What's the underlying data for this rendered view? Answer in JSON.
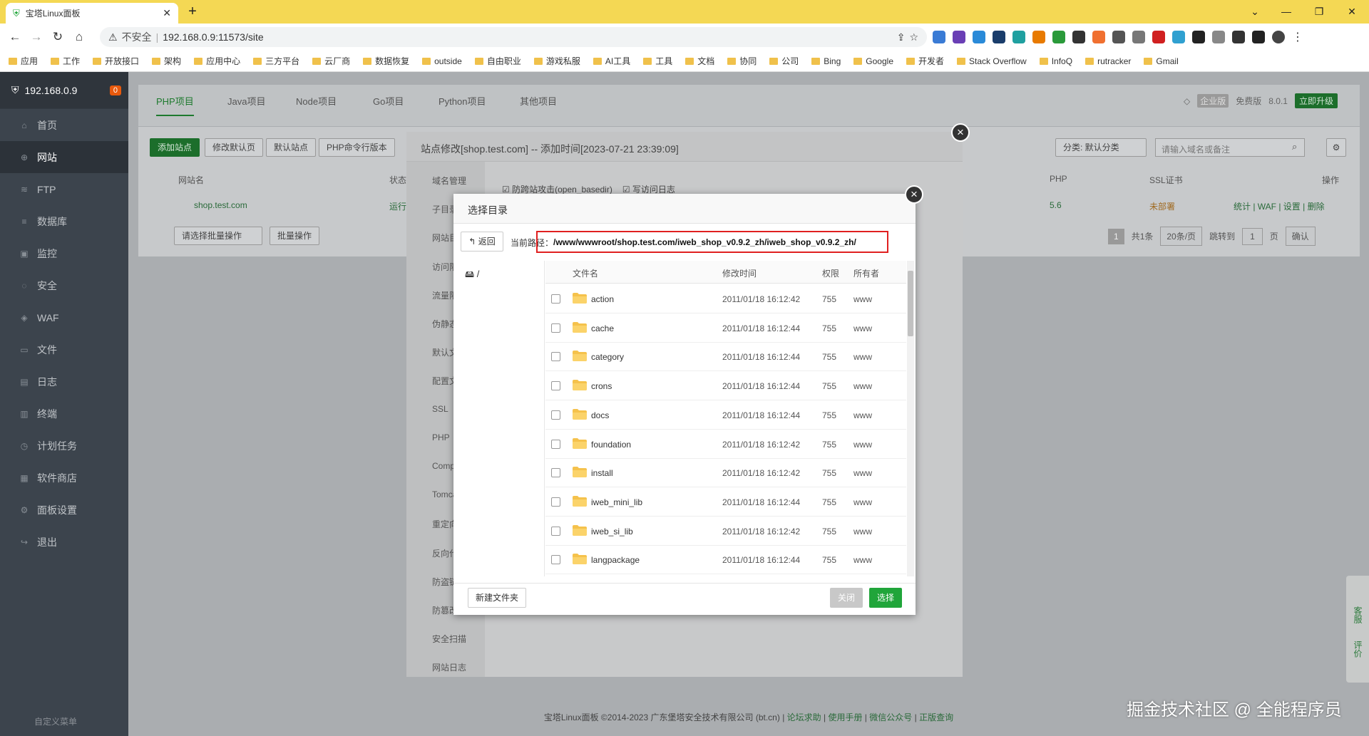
{
  "browser": {
    "tab_title": "宝塔Linux面板",
    "address_security": "不安全",
    "address_url": "192.168.0.9:11573/site",
    "bookmarks": [
      "应用",
      "工作",
      "开放接口",
      "架构",
      "应用中心",
      "三方平台",
      "云厂商",
      "数据恢复",
      "outside",
      "自由职业",
      "游戏私服",
      "AI工具",
      "工具",
      "文档",
      "协同",
      "公司",
      "Bing",
      "Google",
      "开发者",
      "Stack Overflow",
      "InfoQ",
      "rutracker",
      "Gmail"
    ]
  },
  "sidebar": {
    "host": "192.168.0.9",
    "badge": "0",
    "items": [
      "首页",
      "网站",
      "FTP",
      "数据库",
      "监控",
      "安全",
      "WAF",
      "文件",
      "日志",
      "终端",
      "计划任务",
      "软件商店",
      "面板设置",
      "退出"
    ],
    "custom_menu": "自定义菜单"
  },
  "project_tabs": [
    "PHP项目",
    "Java项目",
    "Node项目",
    "Go项目",
    "Python项目",
    "其他项目"
  ],
  "header_right": {
    "edition": "企业版",
    "free": "免费版",
    "version": "8.0.1",
    "upgrade": "立即升级"
  },
  "toolbar": {
    "add_site": "添加站点",
    "edit_default": "修改默认页",
    "default_site": "默认站点",
    "php_cli": "PHP命令行版本",
    "category": "分类: 默认分类",
    "search_placeholder": "请输入域名或备注"
  },
  "site_table": {
    "col_name": "网站名",
    "col_status": "状态",
    "col_php": "PHP",
    "col_ssl": "SSL证书",
    "col_ops": "操作",
    "row": {
      "name": "shop.test.com",
      "status": "运行",
      "php": "5.6",
      "ssl": "未部署",
      "ops": "统计 | WAF | 设置 | 删除"
    },
    "batch_select": "请选择批量操作",
    "batch_btn": "批量操作",
    "page": "1",
    "total": "共1条",
    "per_page": "20条/页",
    "jump_to": "跳转到",
    "jump_page": "1",
    "page_unit": "页",
    "confirm": "确认"
  },
  "site_dialog": {
    "title": "站点修改[shop.test.com] -- 添加时间[2023-07-21 23:39:09]",
    "nav": [
      "域名管理",
      "子目录",
      "网站目录",
      "访问限制",
      "流量限制",
      "伪静态",
      "默认文档",
      "配置文件",
      "SSL",
      "PHP",
      "Composer",
      "Tomcat",
      "重定向",
      "反向代理",
      "防盗链",
      "防篡改",
      "安全扫描",
      "网站日志"
    ],
    "opt1": "防跨站攻击(open_basedir)",
    "opt2": "写访问日志"
  },
  "dir_dialog": {
    "title": "选择目录",
    "back": "返回",
    "path_label": "当前路径：",
    "path": "/www/wwwroot/shop.test.com/iweb_shop_v0.9.2_zh/iweb_shop_v0.9.2_zh/",
    "tree_root": "/",
    "headers": {
      "name": "文件名",
      "time": "修改时间",
      "perm": "权限",
      "owner": "所有者"
    },
    "rows": [
      {
        "name": "action",
        "time": "2011/01/18 16:12:42",
        "perm": "755",
        "owner": "www"
      },
      {
        "name": "cache",
        "time": "2011/01/18 16:12:44",
        "perm": "755",
        "owner": "www"
      },
      {
        "name": "category",
        "time": "2011/01/18 16:12:44",
        "perm": "755",
        "owner": "www"
      },
      {
        "name": "crons",
        "time": "2011/01/18 16:12:44",
        "perm": "755",
        "owner": "www"
      },
      {
        "name": "docs",
        "time": "2011/01/18 16:12:44",
        "perm": "755",
        "owner": "www"
      },
      {
        "name": "foundation",
        "time": "2011/01/18 16:12:42",
        "perm": "755",
        "owner": "www"
      },
      {
        "name": "install",
        "time": "2011/01/18 16:12:42",
        "perm": "755",
        "owner": "www"
      },
      {
        "name": "iweb_mini_lib",
        "time": "2011/01/18 16:12:44",
        "perm": "755",
        "owner": "www"
      },
      {
        "name": "iweb_si_lib",
        "time": "2011/01/18 16:12:42",
        "perm": "755",
        "owner": "www"
      },
      {
        "name": "langpackage",
        "time": "2011/01/18 16:12:44",
        "perm": "755",
        "owner": "www"
      }
    ],
    "new_folder": "新建文件夹",
    "close": "关闭",
    "select": "选择"
  },
  "footer": {
    "copyright": "宝塔Linux面板 ©2014-2023 广东堡塔安全技术有限公司 (bt.cn)",
    "links": [
      "论坛求助",
      "使用手册",
      "微信公众号",
      "正版查询"
    ]
  },
  "float_right": {
    "service": "客服",
    "review": "评价"
  },
  "watermark": "掘金技术社区 @ 全能程序员",
  "colors": {
    "accent": "#20a53a",
    "sidebar": "#3c444d",
    "highlight": "#e02020"
  }
}
